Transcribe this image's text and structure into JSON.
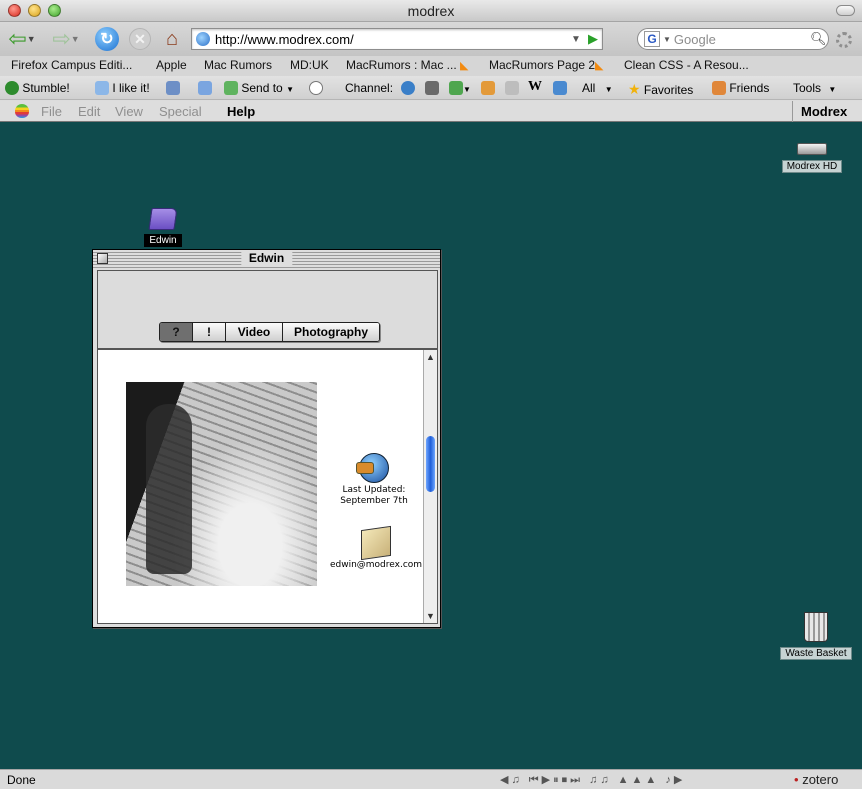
{
  "window": {
    "title": "modrex"
  },
  "navbar": {
    "url": "http://www.modrex.com/",
    "search_placeholder": "Google",
    "search_engine_icon": "G"
  },
  "bookmarks": [
    "Firefox Campus Editi...",
    "Apple",
    "Mac Rumors",
    "MD:UK",
    "MacRumors : Mac ...",
    "MacRumors Page 2",
    "Clean CSS - A Resou..."
  ],
  "stumble": {
    "stumble": "Stumble!",
    "like": "I like it!",
    "send_to": "Send to",
    "channel": "Channel:",
    "all": "All",
    "favorites": "Favorites",
    "friends": "Friends",
    "tools": "Tools"
  },
  "mac_menu": {
    "items": [
      "File",
      "Edit",
      "View",
      "Special"
    ],
    "help": "Help",
    "brand": "Modrex"
  },
  "desktop_icons": {
    "hd": "Modrex HD",
    "folder": "Edwin",
    "trash": "Waste Basket"
  },
  "mac_window": {
    "title": "Edwin",
    "tabs": [
      "?",
      "!",
      "Video",
      "Photography"
    ],
    "last_updated_label": "Last Updated:",
    "last_updated_date": "September 7th",
    "email": "edwin@modrex.com"
  },
  "status": {
    "text": "Done",
    "zotero": "zotero"
  },
  "colors": {
    "desktop": "#0f4b4d",
    "menubar": "#dddddd"
  }
}
